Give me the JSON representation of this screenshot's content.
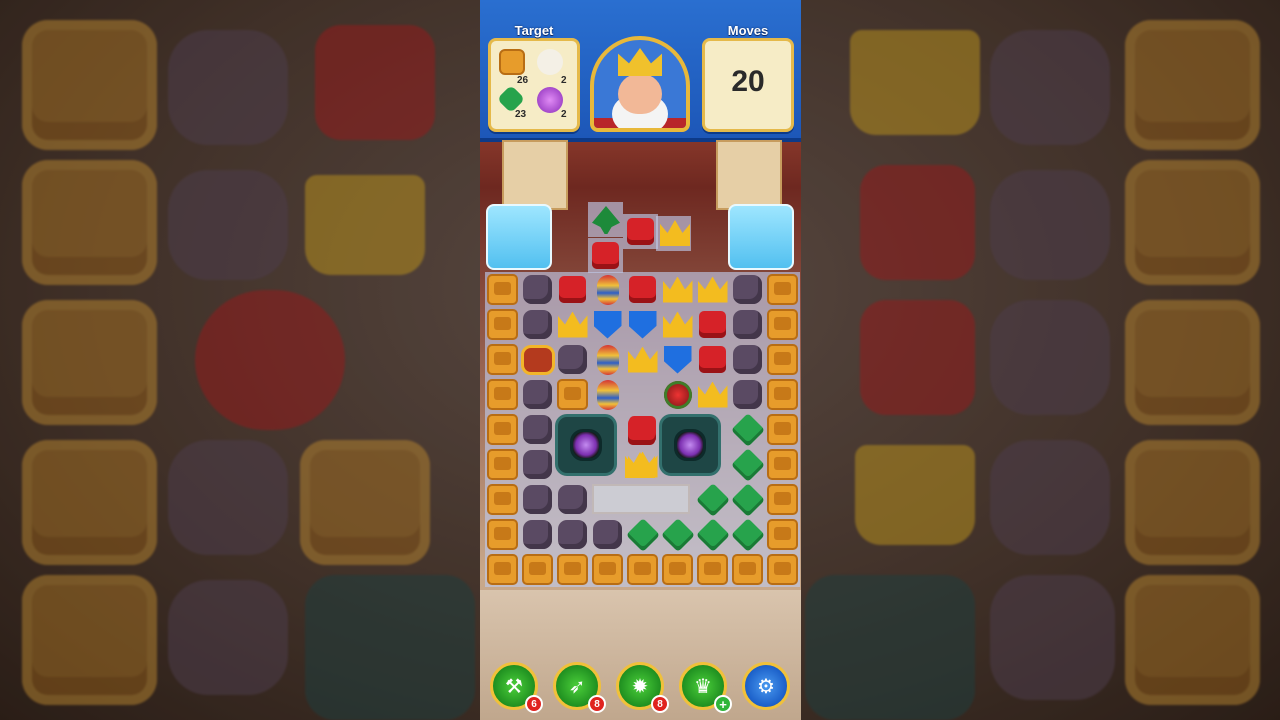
{
  "hud": {
    "target_title": "Target",
    "moves_title": "Moves",
    "moves_value": "20",
    "targets": [
      {
        "icon": "crate-icon",
        "count": "26"
      },
      {
        "icon": "polar-bear-icon",
        "count": "2"
      },
      {
        "icon": "green-gem-icon",
        "count": "23"
      },
      {
        "icon": "purple-orb-icon",
        "count": "2"
      }
    ]
  },
  "boosters": [
    {
      "icon": "hammer-icon",
      "count": "6"
    },
    {
      "icon": "arrow-icon",
      "count": "8"
    },
    {
      "icon": "cannon-icon",
      "count": "8"
    },
    {
      "icon": "jester-hat-icon",
      "count": "+"
    },
    {
      "icon": "gear-icon",
      "count": ""
    }
  ],
  "colors": {
    "hud_blue": "#2a6fd0",
    "gold": "#e8b83a",
    "crate_orange": "#e79c2b"
  }
}
